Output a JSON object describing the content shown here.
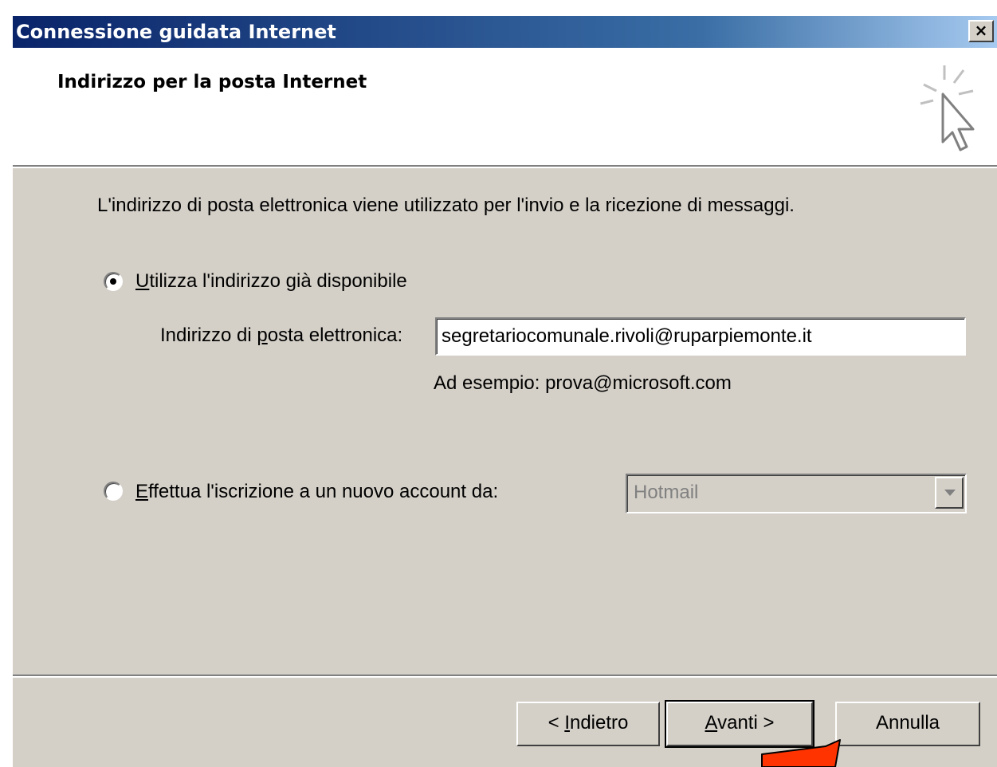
{
  "window": {
    "title": "Connessione guidata Internet",
    "close_label": "×"
  },
  "header": {
    "title": "Indirizzo per la posta Internet",
    "icon": "wizard-cursor-icon"
  },
  "content": {
    "description": "L'indirizzo di posta elettronica viene utilizzato per l'invio e la ricezione di messaggi.",
    "option_existing": {
      "accel": "U",
      "rest": "tilizza l'indirizzo già disponibile",
      "selected": true
    },
    "email_label": {
      "before": "Indirizzo di ",
      "accel": "p",
      "after": "osta elettronica:"
    },
    "email_value": "segretariocomunale.rivoli@ruparpiemonte.it",
    "example": "Ad esempio: prova@microsoft.com",
    "option_new": {
      "accel": "E",
      "rest": "ffettua l'iscrizione a un nuovo account da:",
      "selected": false
    },
    "provider_selected": "Hotmail"
  },
  "buttons": {
    "back": {
      "prefix": "< ",
      "accel": "I",
      "rest": "ndietro"
    },
    "next": {
      "accel": "A",
      "rest": "vanti >"
    },
    "cancel": "Annulla"
  },
  "colors": {
    "titlebar_start": "#0a246a",
    "dialog_face": "#d4d0c8",
    "annotation_arrow": "#ff3300"
  }
}
